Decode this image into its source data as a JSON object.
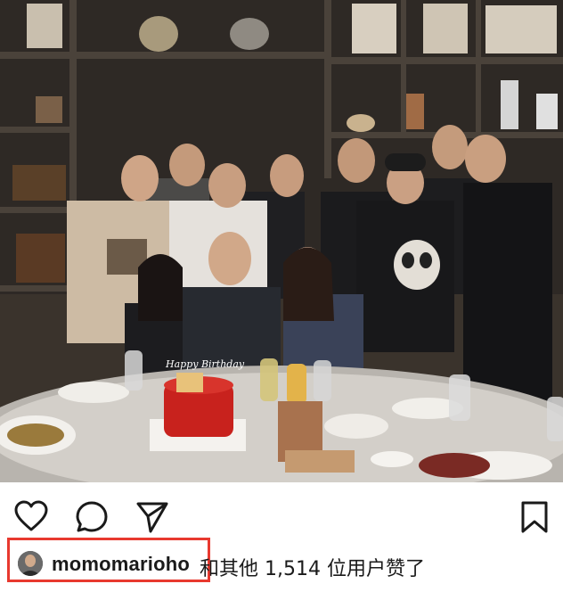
{
  "post": {
    "photo_alt": "group-photo",
    "cake_text": "Happy Birthday"
  },
  "actions": {
    "like_icon": "heart-icon",
    "comment_icon": "comment-icon",
    "share_icon": "send-icon",
    "save_icon": "bookmark-icon"
  },
  "likes": {
    "username": "momomarioho",
    "text": "和其他 1,514 位用户赞了"
  },
  "colors": {
    "highlight": "#e8392f",
    "text": "#1a1a1a"
  }
}
